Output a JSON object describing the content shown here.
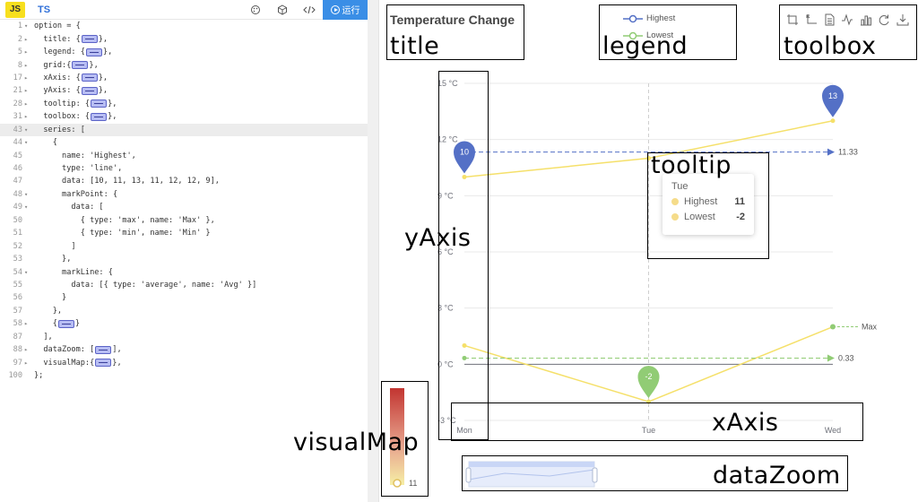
{
  "toolbar": {
    "js_label": "JS",
    "ts_label": "TS",
    "run_label": "运行",
    "icons": [
      "palette-icon",
      "cube-icon",
      "code-icon",
      "run-icon"
    ]
  },
  "code": {
    "active_line": "43",
    "lines": [
      {
        "num": "1",
        "fold": "▾",
        "text": "option = {"
      },
      {
        "num": "2",
        "fold": "▸",
        "text": "  title: {",
        "box": true,
        "after": "},"
      },
      {
        "num": "5",
        "fold": "▸",
        "text": "  legend: {",
        "box": true,
        "after": "},"
      },
      {
        "num": "8",
        "fold": "▸",
        "text": "  grid:{",
        "box": true,
        "after": "},"
      },
      {
        "num": "17",
        "fold": "▸",
        "text": "  xAxis: {",
        "box": true,
        "after": "},"
      },
      {
        "num": "21",
        "fold": "▸",
        "text": "  yAxis: {",
        "box": true,
        "after": "},"
      },
      {
        "num": "28",
        "fold": "▸",
        "text": "  tooltip: {",
        "box": true,
        "after": "},"
      },
      {
        "num": "31",
        "fold": "▸",
        "text": "  toolbox: {",
        "box": true,
        "after": "},"
      },
      {
        "num": "43",
        "fold": "▾",
        "text": "  series: ["
      },
      {
        "num": "44",
        "fold": "▾",
        "text": "    {"
      },
      {
        "num": "45",
        "fold": "",
        "text": "      name: 'Highest',"
      },
      {
        "num": "46",
        "fold": "",
        "text": "      type: 'line',"
      },
      {
        "num": "47",
        "fold": "",
        "text": "      data: [10, 11, 13, 11, 12, 12, 9],"
      },
      {
        "num": "48",
        "fold": "▾",
        "text": "      markPoint: {"
      },
      {
        "num": "49",
        "fold": "▾",
        "text": "        data: ["
      },
      {
        "num": "50",
        "fold": "",
        "text": "          { type: 'max', name: 'Max' },"
      },
      {
        "num": "51",
        "fold": "",
        "text": "          { type: 'min', name: 'Min' }"
      },
      {
        "num": "52",
        "fold": "",
        "text": "        ]"
      },
      {
        "num": "53",
        "fold": "",
        "text": "      },"
      },
      {
        "num": "54",
        "fold": "▾",
        "text": "      markLine: {"
      },
      {
        "num": "55",
        "fold": "",
        "text": "        data: [{ type: 'average', name: 'Avg' }]"
      },
      {
        "num": "56",
        "fold": "",
        "text": "      }"
      },
      {
        "num": "57",
        "fold": "",
        "text": "    },"
      },
      {
        "num": "58",
        "fold": "▸",
        "text": "    {",
        "box": true,
        "after": "}"
      },
      {
        "num": "87",
        "fold": "",
        "text": "  ],"
      },
      {
        "num": "88",
        "fold": "▸",
        "text": "  dataZoom: [",
        "box": true,
        "after": "],"
      },
      {
        "num": "97",
        "fold": "▸",
        "text": "  visualMap:{",
        "box": true,
        "after": "},"
      },
      {
        "num": "100",
        "fold": "",
        "text": "};"
      }
    ]
  },
  "chart": {
    "title": "Temperature Change",
    "legend": [
      {
        "name": "Highest",
        "color": "#5470c6"
      },
      {
        "name": "Lowest",
        "color": "#91cc75"
      }
    ],
    "toolbox_icons": [
      "zoom-icon",
      "zoom-reset-icon",
      "data-view-icon",
      "line-chart-icon",
      "bar-chart-icon",
      "restore-icon",
      "download-icon"
    ],
    "annotations": {
      "title": "title",
      "legend": "legend",
      "toolbox": "toolbox",
      "yAxis": "yAxis",
      "tooltip": "tooltip",
      "visualMap": "visualMap",
      "xAxis": "xAxis",
      "dataZoom": "dataZoom"
    },
    "tooltip": {
      "header": "Tue",
      "rows": [
        {
          "name": "Highest",
          "value": "11"
        },
        {
          "name": "Lowest",
          "value": "-2"
        }
      ]
    },
    "visual_map_value": "11",
    "mark_labels": {
      "highest_avg": "11.33",
      "lowest_avg": "0.33",
      "lowest_max": "Max",
      "max_pin": "13",
      "first_pin": "10",
      "min_pin": "-2"
    }
  },
  "chart_data": {
    "type": "line",
    "title": "Temperature Change",
    "categories": [
      "Mon",
      "Tue",
      "Wed"
    ],
    "yticks": [
      "15 °C",
      "12 °C",
      "9 °C",
      "6 °C",
      "3 °C",
      "0 °C",
      "-3 °C"
    ],
    "ylim": [
      -3,
      15
    ],
    "series": [
      {
        "name": "Highest",
        "values": [
          10,
          11,
          13
        ],
        "color": "#f5e06a",
        "average": 11.33,
        "mark_color": "#5470c6"
      },
      {
        "name": "Lowest",
        "values": [
          1,
          -2,
          2
        ],
        "color": "#f5e06a",
        "average": 0.33,
        "mark_color": "#91cc75"
      }
    ],
    "legend_position": "top-center"
  }
}
